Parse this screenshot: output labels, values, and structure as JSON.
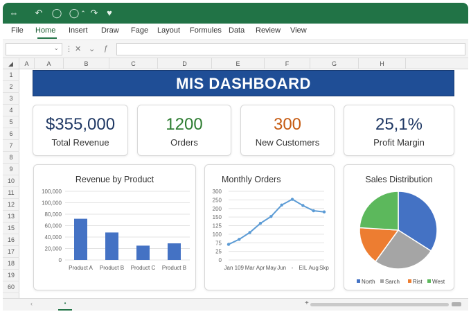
{
  "window": {
    "title_icons": [
      "arrows-icon",
      "undo-icon",
      "circle-icon",
      "circle-icon",
      "chevron-up-icon",
      "redo-icon",
      "heart-icon"
    ]
  },
  "menu": {
    "items": [
      "File",
      "Home",
      "Insert",
      "Draw",
      "Fage",
      "Layout",
      "Formules",
      "Data",
      "Review",
      "View"
    ],
    "active": "Home"
  },
  "formula_bar": {
    "name_box": "",
    "formula": ""
  },
  "columns": [
    "A",
    "A",
    "B",
    "C",
    "D",
    "E",
    "F",
    "G",
    "H"
  ],
  "rows": [
    "1",
    "2",
    "3",
    "4",
    "5",
    "6",
    "7",
    "8",
    "9",
    "10",
    "11",
    "12",
    "13",
    "15",
    "16",
    "17",
    "18",
    "19",
    "60"
  ],
  "dashboard": {
    "title": "MIS DASHBOARD",
    "kpis": [
      {
        "value": "$355,000",
        "label": "Total Revenue",
        "color": "#1f3864"
      },
      {
        "value": "1200",
        "label": "Orders",
        "color": "#2e7d32"
      },
      {
        "value": "300",
        "label": "New Customers",
        "color": "#c55a11"
      },
      {
        "value": "25,1%",
        "label": "Profit Margin",
        "color": "#1f3864"
      }
    ]
  },
  "chart_data": [
    {
      "type": "bar",
      "title": "Revenue by Product",
      "categories": [
        "Product A",
        "Product B",
        "Product C",
        "Product B"
      ],
      "values": [
        72000,
        48000,
        25000,
        29000
      ],
      "ytick_labels": [
        "100,000",
        "100,000",
        "80,000",
        "60,000",
        "40,000",
        "20,000",
        "0"
      ],
      "ylim": [
        0,
        120000
      ],
      "color": "#4472c4"
    },
    {
      "type": "line",
      "title": "Monthly Orders",
      "x": [
        "Jan",
        "109",
        "Mar",
        "Apr",
        "May",
        "Jun",
        "-",
        "EIL",
        "Aug",
        "Skp"
      ],
      "values": [
        68,
        90,
        120,
        160,
        190,
        240,
        265,
        238,
        215,
        210
      ],
      "ytick_labels": [
        "300",
        "250",
        "200",
        "150",
        "125",
        "100",
        "75",
        "25",
        "0"
      ],
      "ylim": [
        0,
        300
      ],
      "color": "#5b9bd5"
    },
    {
      "type": "pie",
      "title": "Sales Distribution",
      "labels": [
        "North",
        "Sarch",
        "Rist",
        "West"
      ],
      "values": [
        34,
        26,
        16,
        24
      ],
      "colors": [
        "#4472c4",
        "#a5a5a5",
        "#ed7d31",
        "#5cb85c"
      ]
    }
  ],
  "status": {
    "sheet_tab": "•",
    "plus": "+"
  }
}
